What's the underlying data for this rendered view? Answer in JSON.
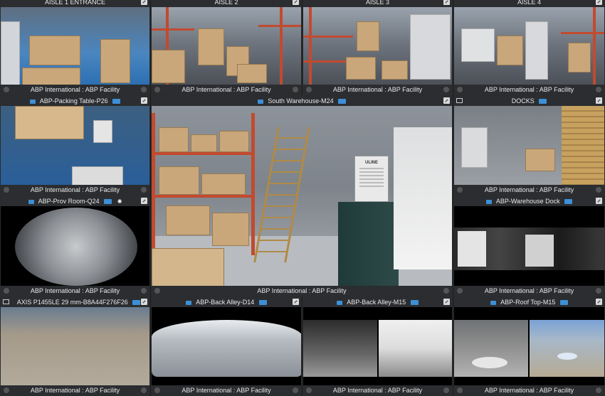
{
  "tiles": [
    {
      "id": "aisle1",
      "header": "AISLE 1 ENTRANCE",
      "footer": "ABP International : ABP Facility"
    },
    {
      "id": "aisle2",
      "header": "AISLE 2",
      "footer": "ABP International : ABP Facility"
    },
    {
      "id": "aisle3",
      "header": "AISLE 3",
      "footer": "ABP International : ABP Facility"
    },
    {
      "id": "aisle4",
      "header": "AISLE 4",
      "footer": "ABP International : ABP Facility"
    },
    {
      "id": "packing",
      "header": "ABP-Packing Table-P26",
      "footer": "ABP International : ABP Facility"
    },
    {
      "id": "south",
      "header": "South Warehouse-M24",
      "footer": "ABP International : ABP Facility"
    },
    {
      "id": "docks",
      "header": "DOCKS",
      "footer": "ABP International : ABP Facility"
    },
    {
      "id": "prov",
      "header": "ABP-Prov Room-Q24",
      "footer": "ABP International : ABP Facility"
    },
    {
      "id": "whdock",
      "header": "ABP-Warehouse Dock",
      "footer": "ABP International : ABP Facility"
    },
    {
      "id": "axis",
      "header": "AXIS P1455LE 29 mm-B8A44F276F26",
      "footer": "ABP International : ABP Facility"
    },
    {
      "id": "backd14",
      "header": "ABP-Back Alley-D14",
      "footer": "ABP International : ABP Facility"
    },
    {
      "id": "backm15",
      "header": "ABP-Back Alley-M15",
      "footer": "ABP International : ABP Facility"
    },
    {
      "id": "roofm15",
      "header": "ABP-Roof Top-M15",
      "footer": "ABP International : ABP Facility"
    }
  ],
  "scene_text": {
    "uline_sign": "ULINE"
  },
  "colors": {
    "accent": "#3d8fd6",
    "bar_bg": "#2b2d30",
    "rack_red": "#c24a2f"
  }
}
